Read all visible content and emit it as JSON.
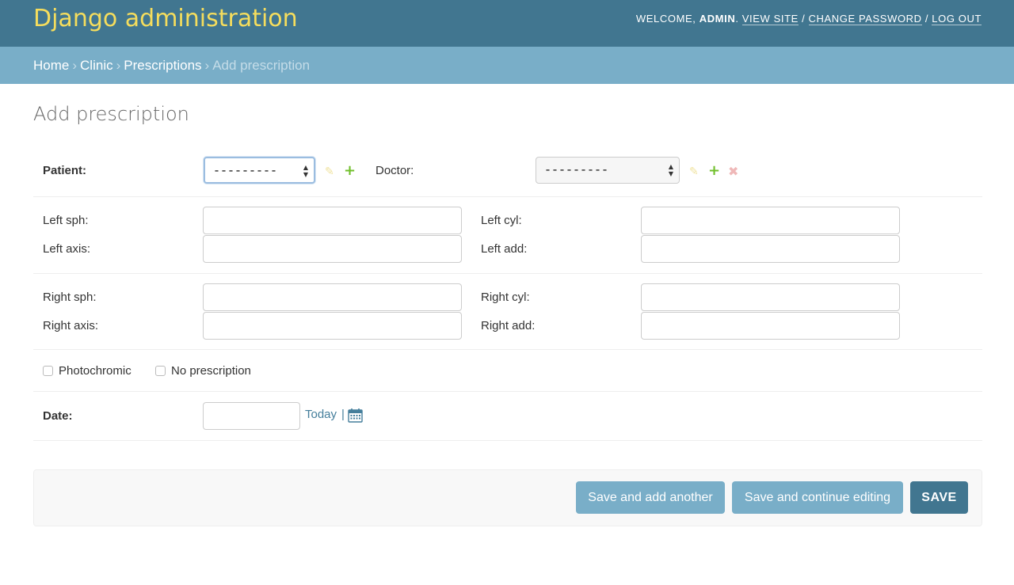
{
  "header": {
    "branding": "Django administration",
    "welcome": "WELCOME, ",
    "username": "ADMIN",
    "dot": ". ",
    "view_site": "VIEW SITE",
    "change_password": "CHANGE PASSWORD",
    "log_out": "LOG OUT",
    "separator": " / "
  },
  "breadcrumbs": {
    "home": "Home",
    "clinic": "Clinic",
    "prescriptions": "Prescriptions",
    "current": "Add prescription",
    "separator": "›"
  },
  "page": {
    "title": "Add prescription"
  },
  "form": {
    "patient": {
      "label": "Patient:",
      "value": "---------"
    },
    "doctor": {
      "label": "Doctor:",
      "value": "---------"
    },
    "left_sph": {
      "label": "Left sph:",
      "value": ""
    },
    "left_cyl": {
      "label": "Left cyl:",
      "value": ""
    },
    "left_axis": {
      "label": "Left axis:",
      "value": ""
    },
    "left_add": {
      "label": "Left add:",
      "value": ""
    },
    "right_sph": {
      "label": "Right sph:",
      "value": ""
    },
    "right_cyl": {
      "label": "Right cyl:",
      "value": ""
    },
    "right_axis": {
      "label": "Right axis:",
      "value": ""
    },
    "right_add": {
      "label": "Right add:",
      "value": ""
    },
    "photochromic": {
      "label": "Photochromic",
      "checked": false
    },
    "no_prescription": {
      "label": "No prescription",
      "checked": false
    },
    "date": {
      "label": "Date:",
      "value": "",
      "today_label": "Today",
      "pipe": "|"
    }
  },
  "icons": {
    "edit": "pencil-icon",
    "add": "plus-icon",
    "delete": "cross-icon",
    "calendar": "calendar-icon"
  },
  "buttons": {
    "save_add_another": "Save and add another",
    "save_continue": "Save and continue editing",
    "save": "SAVE"
  },
  "colors": {
    "header_bg": "#417690",
    "breadcrumb_bg": "#79aec8",
    "branding": "#f5dd5d",
    "link": "#447e9b",
    "add_green": "#70bf2b"
  }
}
